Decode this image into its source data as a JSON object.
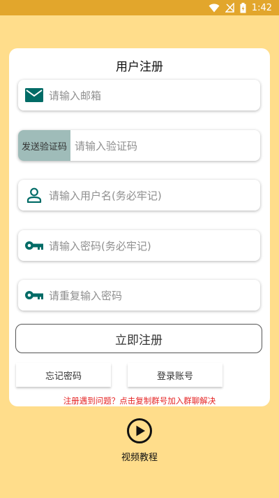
{
  "status_bar": {
    "time": "1:42",
    "icons": [
      "wifi-icon",
      "no-signal-icon",
      "battery-icon"
    ]
  },
  "form": {
    "title": "用户注册",
    "email_placeholder": "请输入邮箱",
    "send_code_label": "发送验证码",
    "code_placeholder": "请输入验证码",
    "username_placeholder": "请输入用户名(务必牢记)",
    "password_placeholder": "请输入密码(务必牢记)",
    "confirm_password_placeholder": "请重复输入密码",
    "register_label": "立即注册",
    "forgot_password_label": "忘记密码",
    "login_label": "登录账号",
    "help_text": "注册遇到问题？点击复制群号加入群聊解决"
  },
  "video": {
    "label": "视频教程",
    "icon": "play-icon"
  },
  "colors": {
    "background": "#ffdd8b",
    "status_bar": "#e2a62c",
    "icon_teal": "#006b66",
    "send_code_bg": "#9fbcb9",
    "help_red": "#e52424"
  }
}
